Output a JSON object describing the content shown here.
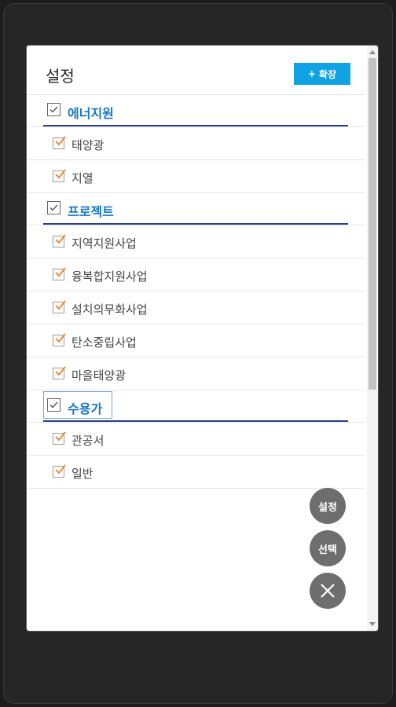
{
  "header": {
    "title": "설정",
    "expand_button": "확장"
  },
  "groups": [
    {
      "label": "에너지원",
      "items": [
        "태양광",
        "지열"
      ]
    },
    {
      "label": "프로젝트",
      "items": [
        "지역지원사업",
        "융복합지원사업",
        "설치의무화사업",
        "탄소중립사업",
        "마을태양광"
      ]
    },
    {
      "label": "수용가",
      "items": [
        "관공서",
        "일반"
      ]
    }
  ],
  "fabs": {
    "settings": "설정",
    "select": "선택"
  },
  "colors": {
    "accent": "#0fa3e6",
    "group_label": "#1477c9",
    "underline": "#2a3f8f",
    "check_orange": "#f08a3c",
    "fab": "#6e6e6e"
  }
}
